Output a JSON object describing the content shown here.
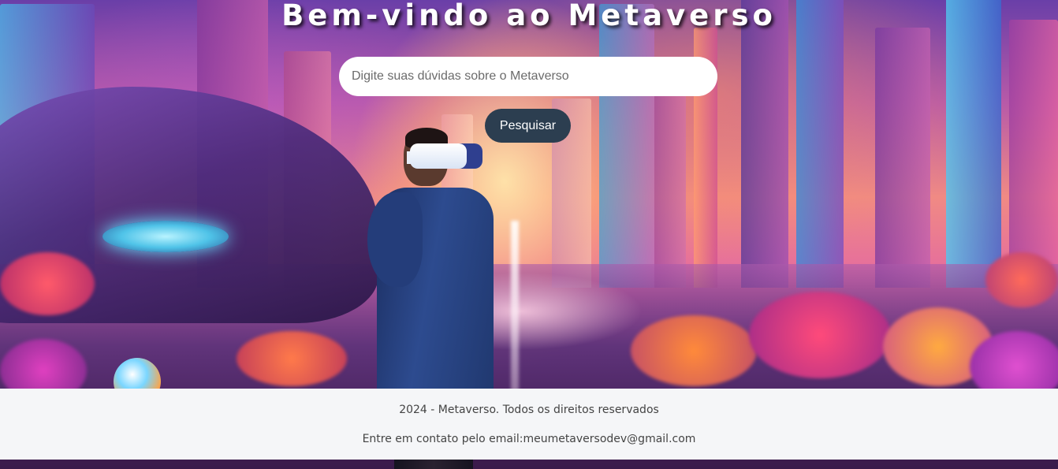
{
  "hero": {
    "title": "Bem-vindo ao Metaverso",
    "image": "vr-person-futuristic-city"
  },
  "search": {
    "placeholder": "Digite suas dúvidas sobre o Metaverso",
    "value": "",
    "button_label": "Pesquisar"
  },
  "footer": {
    "copyright": "2024 - Metaverso. Todos os direitos reservados",
    "contact": "Entre em contato pelo email:meumetaversodev@gmail.com"
  },
  "colors": {
    "button_bg": "#2c3e50",
    "footer_bg": "#f5f6f8",
    "title_text": "#ffffff"
  }
}
